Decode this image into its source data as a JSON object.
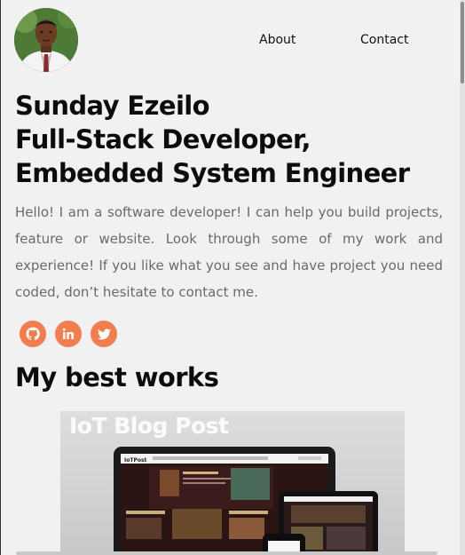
{
  "nav": {
    "about": "About",
    "contact": "Contact"
  },
  "hero": {
    "name": "Sunday Ezeilo",
    "role1": "Full-Stack Developer,",
    "role2": "Embedded System Engineer",
    "intro": "Hello! I am a software developer! I can help you build projects, feature or website. Look through some of my work and experience! If you like what you see and have project you need coded, don’t hesitate to contact me."
  },
  "socials": [
    {
      "icon": "github-icon"
    },
    {
      "icon": "linkedin-icon"
    },
    {
      "icon": "twitter-icon"
    }
  ],
  "colors": {
    "accent": "#f27e4e",
    "background": "#f1f1f1",
    "text": "#0c0c0c",
    "muted_text": "#6a6a6a"
  },
  "works": {
    "heading": "My best works",
    "items": [
      {
        "title": "IoT Blog Post",
        "screen_logo": "IoTPost"
      }
    ]
  }
}
